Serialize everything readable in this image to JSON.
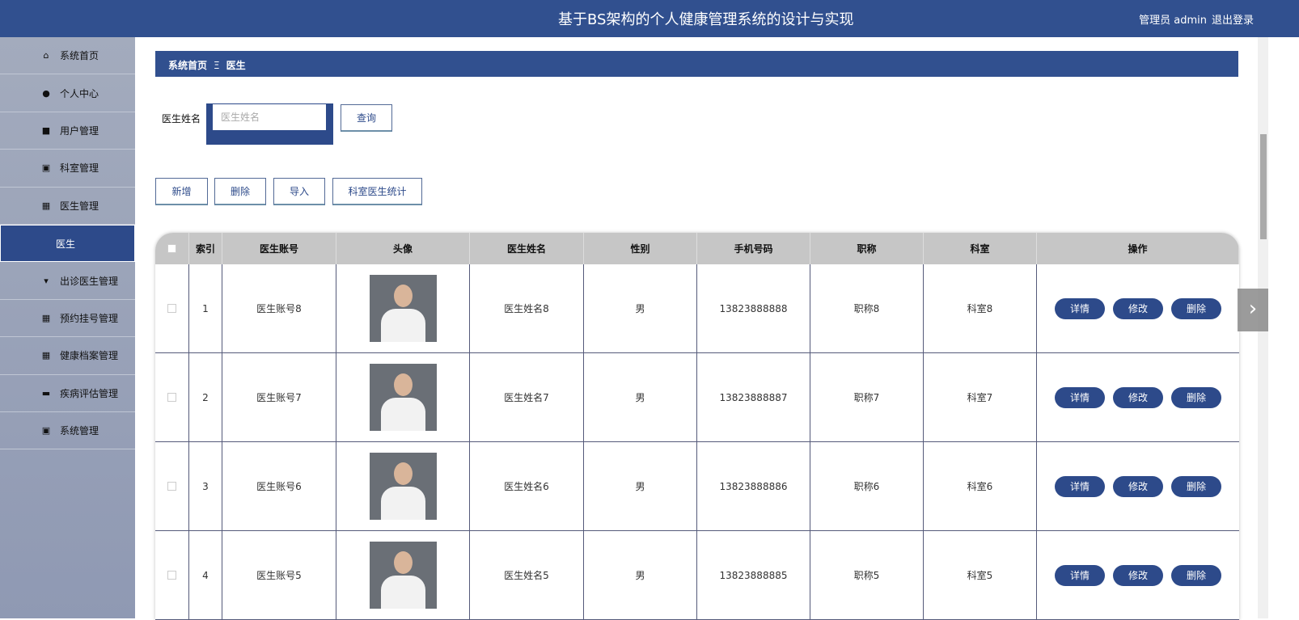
{
  "header": {
    "title": "基于BS架构的个人健康管理系统的设计与实现",
    "user": "管理员 admin",
    "logout": "退出登录"
  },
  "sidebar": {
    "items": [
      {
        "label": "系统首页",
        "icon": "home-icon",
        "glyph": "⌂"
      },
      {
        "label": "个人中心",
        "icon": "user-icon",
        "glyph": "●"
      },
      {
        "label": "用户管理",
        "icon": "briefcase-icon",
        "glyph": "■"
      },
      {
        "label": "科室管理",
        "icon": "clipboard-x-icon",
        "glyph": "▣"
      },
      {
        "label": "医生管理",
        "icon": "grid-icon",
        "glyph": "▦"
      },
      {
        "label": "医生",
        "active": true
      },
      {
        "label": "出诊医生管理",
        "icon": "pin-icon",
        "glyph": "▾"
      },
      {
        "label": "预约挂号管理",
        "icon": "grid-icon",
        "glyph": "▦"
      },
      {
        "label": "健康档案管理",
        "icon": "grid-icon",
        "glyph": "▦"
      },
      {
        "label": "疾病评估管理",
        "icon": "wallet-icon",
        "glyph": "▬"
      },
      {
        "label": "系统管理",
        "icon": "clipboard-check-icon",
        "glyph": "▣"
      }
    ]
  },
  "breadcrumb": {
    "home": "系统首页",
    "sep": "Ξ",
    "current": "医生"
  },
  "search": {
    "label": "医生姓名",
    "placeholder": "医生姓名",
    "value": "",
    "button": "查询"
  },
  "actions": {
    "add": "新增",
    "delete": "删除",
    "import": "导入",
    "stats": "科室医生统计"
  },
  "table": {
    "columns": [
      "索引",
      "医生账号",
      "头像",
      "医生姓名",
      "性别",
      "手机号码",
      "职称",
      "科室",
      "操作"
    ],
    "rows": [
      {
        "index": "1",
        "account": "医生账号8",
        "name": "医生姓名8",
        "gender": "男",
        "phone": "13823888888",
        "title": "职称8",
        "dept": "科室8"
      },
      {
        "index": "2",
        "account": "医生账号7",
        "name": "医生姓名7",
        "gender": "男",
        "phone": "13823888887",
        "title": "职称7",
        "dept": "科室7"
      },
      {
        "index": "3",
        "account": "医生账号6",
        "name": "医生姓名6",
        "gender": "男",
        "phone": "13823888886",
        "title": "职称6",
        "dept": "科室6"
      },
      {
        "index": "4",
        "account": "医生账号5",
        "name": "医生姓名5",
        "gender": "男",
        "phone": "13823888885",
        "title": "职称5",
        "dept": "科室5"
      }
    ],
    "ops": {
      "detail": "详情",
      "edit": "修改",
      "delete": "删除"
    }
  },
  "colors": {
    "primary": "#31508f",
    "sidebar": "#9aa3b8",
    "header_row": "#c6c6c6"
  }
}
